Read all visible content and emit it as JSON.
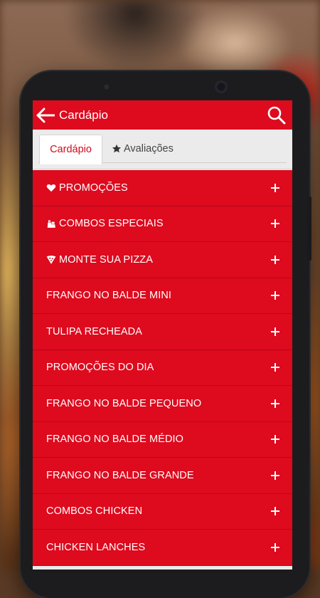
{
  "app": {
    "title": "Cardápio"
  },
  "tabs": [
    {
      "label": "Cardápio",
      "active": true
    },
    {
      "label": "Avaliações",
      "active": false,
      "icon": "star-icon"
    }
  ],
  "menu": {
    "items": [
      {
        "label": "PROMOÇÕES",
        "icon": "heart-icon"
      },
      {
        "label": "COMBOS ESPECIAIS",
        "icon": "combo-icon"
      },
      {
        "label": "MONTE SUA PIZZA",
        "icon": "pizza-icon"
      },
      {
        "label": "FRANGO NO BALDE MINI"
      },
      {
        "label": "TULIPA RECHEADA"
      },
      {
        "label": "PROMOÇÕES DO DIA"
      },
      {
        "label": "FRANGO NO BALDE PEQUENO"
      },
      {
        "label": "FRANGO NO BALDE MÉDIO"
      },
      {
        "label": "FRANGO NO BALDE GRANDE"
      },
      {
        "label": "COMBOS CHICKEN"
      },
      {
        "label": "CHICKEN LANCHES"
      }
    ]
  },
  "colors": {
    "accent": "#de0a1e",
    "background": "#e9e9e9"
  }
}
